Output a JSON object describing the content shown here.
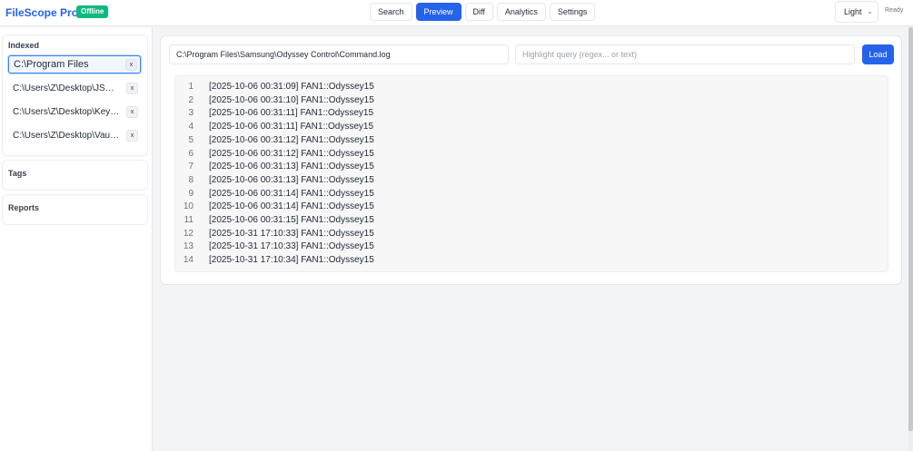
{
  "header": {
    "brand": "FileScope Pro+",
    "badge": "Offline",
    "nav": [
      "Search",
      "Preview",
      "Diff",
      "Analytics",
      "Settings"
    ],
    "active_nav": "Preview",
    "theme": "Light",
    "status": "Ready"
  },
  "sidebar": {
    "indexed_title": "Indexed",
    "folders": [
      {
        "label": "C:\\Program Files",
        "remove": "x"
      },
      {
        "label": "C:\\Users\\Z\\Desktop\\JSONViewer",
        "remove": "x"
      },
      {
        "label": "C:\\Users\\Z\\Desktop\\KeyManager",
        "remove": "x"
      },
      {
        "label": "C:\\Users\\Z\\Desktop\\VaultSync",
        "remove": "x"
      }
    ],
    "tags_title": "Tags",
    "reports_title": "Reports"
  },
  "main": {
    "path_value": "C:\\Program Files\\Samsung\\Odyssey Control\\Command.log",
    "query_placeholder": "Highlight query (regex... or text)",
    "load_label": "Load",
    "lines": [
      {
        "n": "1",
        "text": "[2025-10-06 00:31:09] FAN1::Odyssey15"
      },
      {
        "n": "2",
        "text": "[2025-10-06 00:31:10] FAN1::Odyssey15"
      },
      {
        "n": "3",
        "text": "[2025-10-06 00:31:11] FAN1::Odyssey15"
      },
      {
        "n": "4",
        "text": "[2025-10-06 00:31:11] FAN1::Odyssey15"
      },
      {
        "n": "5",
        "text": "[2025-10-06 00:31:12] FAN1::Odyssey15"
      },
      {
        "n": "6",
        "text": "[2025-10-06 00:31:12] FAN1::Odyssey15"
      },
      {
        "n": "7",
        "text": "[2025-10-06 00:31:13] FAN1::Odyssey15"
      },
      {
        "n": "8",
        "text": "[2025-10-06 00:31:13] FAN1::Odyssey15"
      },
      {
        "n": "9",
        "text": "[2025-10-06 00:31:14] FAN1::Odyssey15"
      },
      {
        "n": "10",
        "text": "[2025-10-06 00:31:14] FAN1::Odyssey15"
      },
      {
        "n": "11",
        "text": "[2025-10-06 00:31:15] FAN1::Odyssey15"
      },
      {
        "n": "12",
        "text": "[2025-10-31 17:10:33] FAN1::Odyssey15"
      },
      {
        "n": "13",
        "text": "[2025-10-31 17:10:33] FAN1::Odyssey15"
      },
      {
        "n": "14",
        "text": "[2025-10-31 17:10:34] FAN1::Odyssey15"
      }
    ]
  },
  "colors": {
    "accent": "#2563eb",
    "badge": "#10b981"
  }
}
